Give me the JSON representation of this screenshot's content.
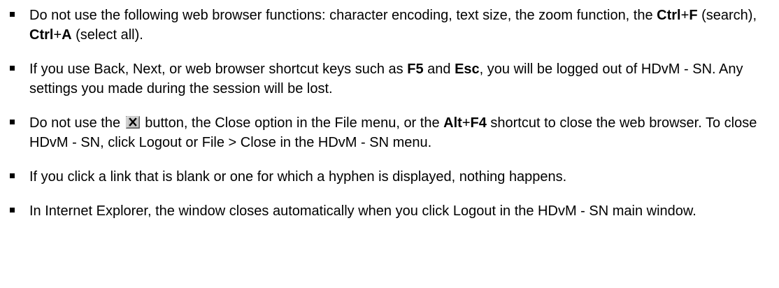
{
  "notes": [
    {
      "parts": [
        {
          "t": "text",
          "v": "Do not use the following web browser functions: character encoding, text size, the zoom function, the "
        },
        {
          "t": "bold",
          "v": "Ctrl"
        },
        {
          "t": "text",
          "v": "+"
        },
        {
          "t": "bold",
          "v": "F"
        },
        {
          "t": "text",
          "v": " (search), "
        },
        {
          "t": "bold",
          "v": "Ctrl"
        },
        {
          "t": "text",
          "v": "+"
        },
        {
          "t": "bold",
          "v": "A"
        },
        {
          "t": "text",
          "v": " (select all)."
        }
      ]
    },
    {
      "parts": [
        {
          "t": "text",
          "v": "If you use Back, Next, or web browser shortcut keys such as "
        },
        {
          "t": "bold",
          "v": "F5"
        },
        {
          "t": "text",
          "v": " and "
        },
        {
          "t": "bold",
          "v": "Esc"
        },
        {
          "t": "text",
          "v": ", you will be logged out of HDvM - SN. Any settings you made during the session will be lost."
        }
      ]
    },
    {
      "parts": [
        {
          "t": "text",
          "v": "Do not use the "
        },
        {
          "t": "icon",
          "v": "close-window-icon"
        },
        {
          "t": "text",
          "v": " button, the Close option in the File menu, or the "
        },
        {
          "t": "bold",
          "v": "Alt"
        },
        {
          "t": "text",
          "v": "+"
        },
        {
          "t": "bold",
          "v": "F4"
        },
        {
          "t": "text",
          "v": " shortcut to close the web browser. To close HDvM - SN, click Logout or File > Close in the HDvM - SN menu."
        }
      ]
    },
    {
      "parts": [
        {
          "t": "text",
          "v": "If you click a link that is blank or one for which a hyphen is displayed, nothing happens."
        }
      ]
    },
    {
      "parts": [
        {
          "t": "text",
          "v": "In Internet Explorer, the window closes automatically when you click Logout in the HDvM - SN main window."
        }
      ]
    }
  ]
}
